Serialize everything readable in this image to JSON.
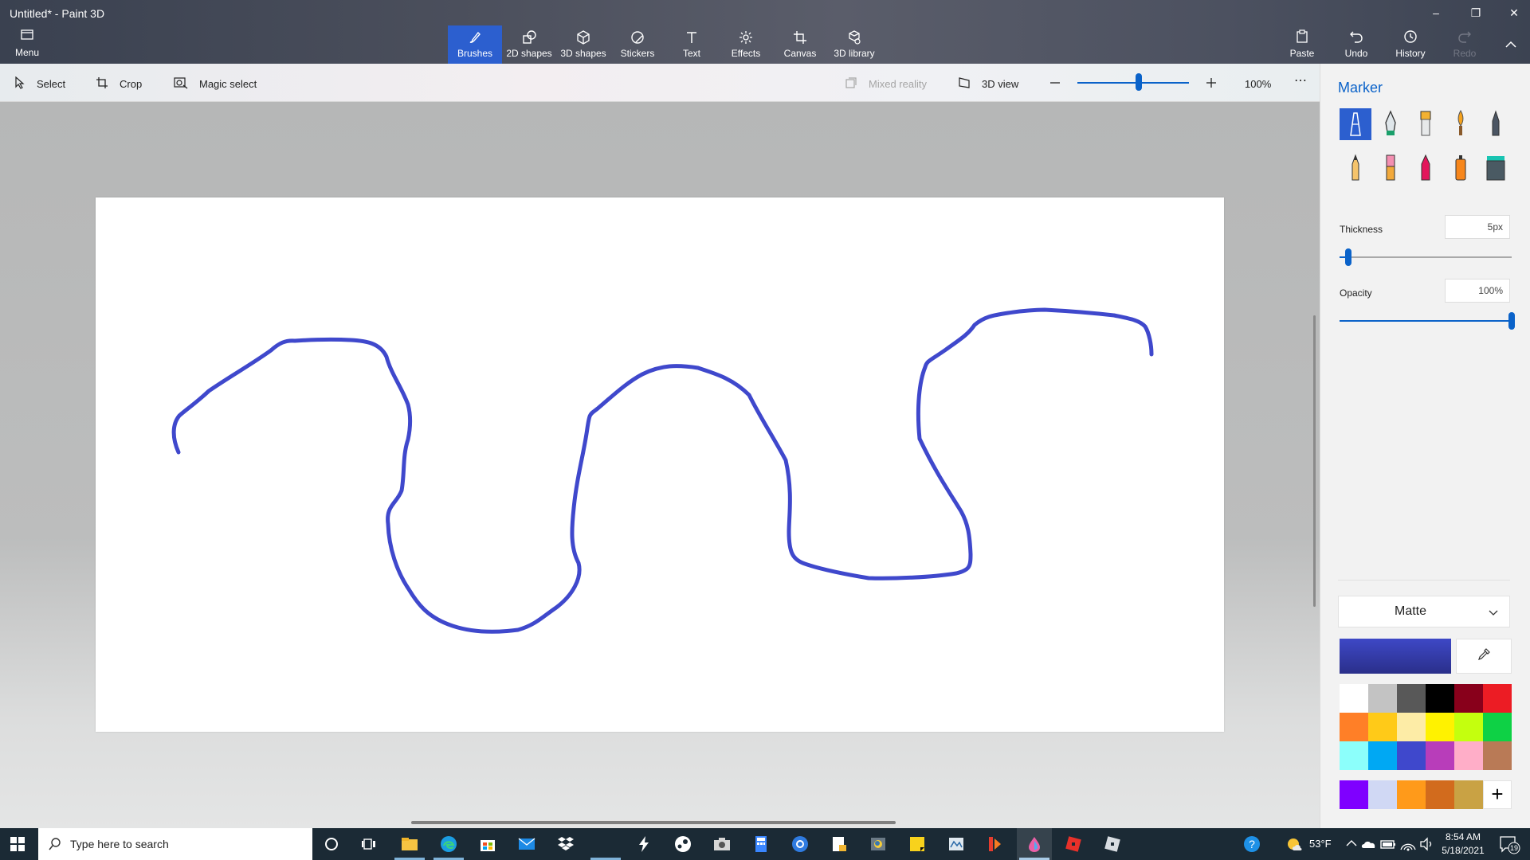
{
  "window": {
    "title": "Untitled* - Paint 3D"
  },
  "ribbon": {
    "menu_label": "Menu",
    "tabs": [
      {
        "label": "Brushes",
        "icon": "brush-icon"
      },
      {
        "label": "2D shapes",
        "icon": "2d-shapes-icon"
      },
      {
        "label": "3D shapes",
        "icon": "3d-shapes-icon"
      },
      {
        "label": "Stickers",
        "icon": "stickers-icon"
      },
      {
        "label": "Text",
        "icon": "text-icon"
      },
      {
        "label": "Effects",
        "icon": "effects-icon"
      },
      {
        "label": "Canvas",
        "icon": "canvas-icon"
      },
      {
        "label": "3D library",
        "icon": "3d-library-icon"
      }
    ],
    "active_tab": "Brushes",
    "paste_label": "Paste",
    "undo_label": "Undo",
    "history_label": "History",
    "redo_label": "Redo",
    "accent": "#2c5fcf"
  },
  "toolbar": {
    "select_label": "Select",
    "crop_label": "Crop",
    "magic_select_label": "Magic select",
    "mixed_reality_label": "Mixed reality",
    "view_3d_label": "3D view",
    "zoom_value": "100%",
    "zoom_level": 0.55
  },
  "panel": {
    "title": "Marker",
    "brushes": [
      "marker",
      "calligraphy-pen",
      "oil-brush",
      "watercolor",
      "pixel-pen",
      "pencil",
      "eraser",
      "crayon",
      "spray-can",
      "fill"
    ],
    "selected_brush": "marker",
    "thickness_label": "Thickness",
    "thickness_value": "5px",
    "thickness_level": 0.05,
    "opacity_label": "Opacity",
    "opacity_value": "100%",
    "opacity_level": 1.0,
    "finish_value": "Matte",
    "current_color": "#3e48c6",
    "palette": [
      "#ffffff",
      "#c3c3c3",
      "#585858",
      "#000000",
      "#88001b",
      "#ec1c24",
      "#ff7f27",
      "#ffca18",
      "#fdeca6",
      "#fff200",
      "#c4ff0e",
      "#0ed145",
      "#8cfffb",
      "#00a8f3",
      "#3f48cc",
      "#b83dba",
      "#ffaec8",
      "#b97a56"
    ],
    "custom_colors": [
      "#7f00ff",
      "#d0d8f4",
      "#ff9a1a",
      "#d26b1d",
      "#c9a244"
    ],
    "add_color_label": "+"
  },
  "canvas": {
    "stroke_color": "#3f48cc"
  },
  "taskbar": {
    "search_placeholder": "Type here to search",
    "apps": [
      "task-view-icon",
      "cortana-icon",
      "file-explorer-icon",
      "edge-icon",
      "store-icon",
      "mail-icon",
      "dropbox-icon",
      "bolt-icon",
      "steam-icon",
      "camera-icon",
      "calculator-icon",
      "chrome-icon",
      "notepad-icon",
      "python-icon",
      "sticky-notes-icon",
      "sketch-icon",
      "tool-icon",
      "paint-3d-icon",
      "roblox-icon",
      "roblox-studio-icon"
    ],
    "temperature": "53°F",
    "time": "8:54 AM",
    "date": "5/18/2021",
    "notification_count": "19"
  }
}
